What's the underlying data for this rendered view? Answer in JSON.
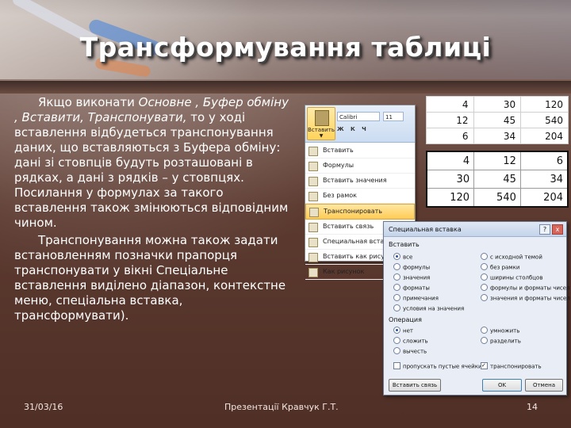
{
  "slide": {
    "title": "Трансформування таблиці",
    "paragraph1_lead": "Якщо виконати ",
    "paragraph1_italic": "Основне , Буфер обміну , Вставити, Транспонувати,",
    "paragraph1_rest": " то у ході вставлення відбудеться транспонування даних, що вставляються з Буфера обміну: дані зі стовпців будуть розташовані в рядках, а дані з рядків – у стовпцях. Посилання у формулах за такого вставлення також змінюються відповідним чином.",
    "paragraph2": "Транспонування можна також задати встановленням позначки прапорця транспонувати у вікні Спеціальне вставлення виділено діапазон, контекстне меню, спеціальна вставка, трансформувати)."
  },
  "footer": {
    "date": "31/03/16",
    "author": "Презентації Кравчук Г.Т.",
    "page": "14"
  },
  "paste_menu": {
    "paste_button": "Вставить",
    "font_name": "Calibri",
    "font_size": "11",
    "format_row": "Ж К Ч",
    "items": [
      "Вставить",
      "Формулы",
      "Вставить значения",
      "Без рамок",
      "Транспонировать",
      "Вставить связь",
      "Специальная вставка...",
      "Вставить как рисунок",
      "Как рисунок"
    ],
    "highlighted_index": 4
  },
  "table_original": [
    [
      "4",
      "30",
      "120"
    ],
    [
      "12",
      "45",
      "540"
    ],
    [
      "6",
      "34",
      "204"
    ]
  ],
  "table_transposed": [
    [
      "4",
      "12",
      "6"
    ],
    [
      "30",
      "45",
      "34"
    ],
    [
      "120",
      "540",
      "204"
    ]
  ],
  "dialog": {
    "title": "Специальная вставка",
    "help": "?",
    "close": "x",
    "paste_group": "Вставить",
    "paste_left": [
      "все",
      "формулы",
      "значения",
      "форматы",
      "примечания",
      "условия на значения"
    ],
    "paste_right": [
      "с исходной темой",
      "без рамки",
      "ширины столбцов",
      "формулы и форматы чисел",
      "значения и форматы чисел"
    ],
    "op_group": "Операция",
    "op_left": [
      "нет",
      "сложить",
      "вычесть"
    ],
    "op_right": [
      "умножить",
      "разделить"
    ],
    "skip_blanks": "пропускать пустые ячейки",
    "transpose": "транспонировать",
    "paste_link_button": "Вставить связь",
    "ok_button": "OK",
    "cancel_button": "Отмена"
  },
  "colors": {
    "accent_highlight": "#ffcc55",
    "title_text": "#ffffff"
  }
}
